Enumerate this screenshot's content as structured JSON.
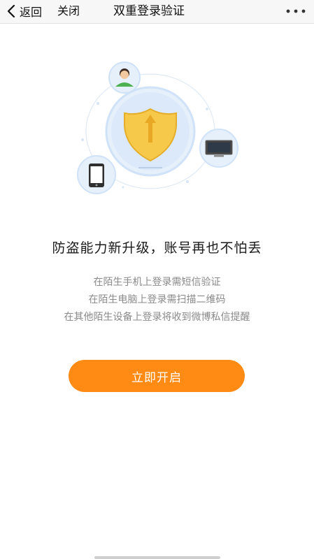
{
  "nav": {
    "back_label": "返回",
    "close_label": "关闭",
    "title": "双重登录验证",
    "more_icon": "more-dots-icon",
    "back_icon": "chevron-left-icon"
  },
  "hero": {
    "icons": [
      "user-avatar-icon",
      "shield-arrow-icon",
      "monitor-icon",
      "phone-icon"
    ]
  },
  "headline": "防盗能力新升级，账号再也不怕丢",
  "descriptions": [
    "在陌生手机上登录需短信验证",
    "在陌生电脑上登录需扫描二维码",
    "在其他陌生设备上登录将收到微博私信提醒"
  ],
  "cta_label": "立即开启",
  "colors": {
    "accent": "#ff8a14",
    "shield": "#f6c94a",
    "circle": "#e6f0fb",
    "ring": "#cfe2f7"
  }
}
